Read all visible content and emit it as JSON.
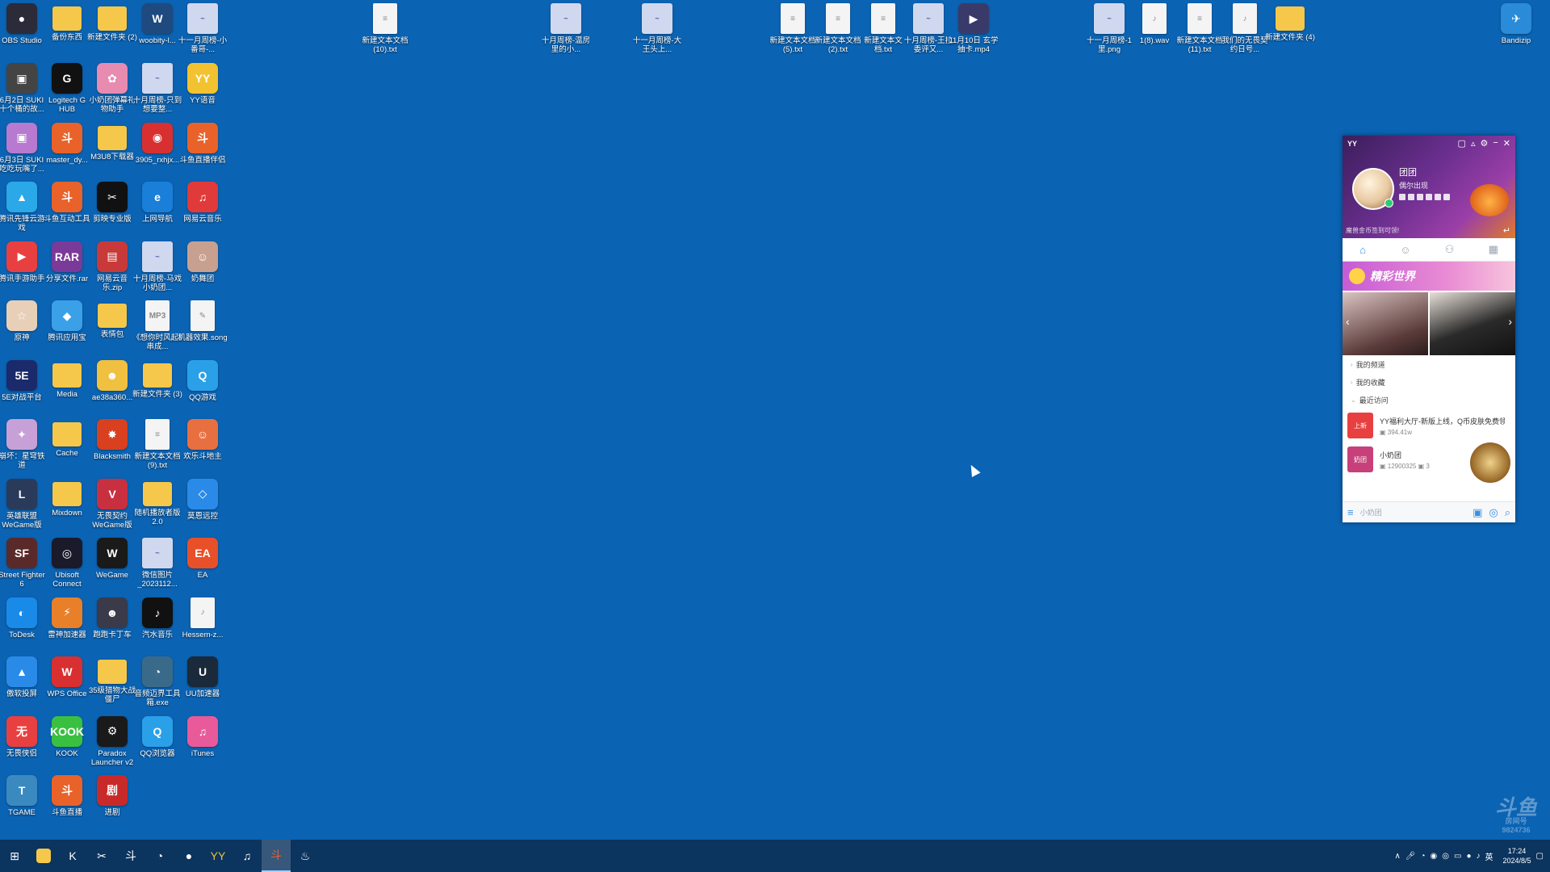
{
  "desktop": {
    "icons": [
      {
        "label": "OBS Studio",
        "color": "#2b2b3a",
        "kind": "app",
        "text": "●"
      },
      {
        "label": "新建文本文档 (10).txt",
        "kind": "doc",
        "text": "≡"
      },
      {
        "label": "十月周榜-温房里的小...",
        "kind": "pic",
        "text": "~"
      },
      {
        "label": "十一月周榜-大王头上...",
        "kind": "pic",
        "text": "~"
      },
      {
        "label": "新建文本文档 (5).txt",
        "kind": "doc",
        "text": "≡"
      },
      {
        "label": "新建文本文档 (2).txt",
        "kind": "doc",
        "text": "≡"
      },
      {
        "label": "新建文本文档.txt",
        "kind": "doc",
        "text": "≡"
      },
      {
        "label": "十月周榜-王拉委评又...",
        "kind": "pic",
        "text": "~"
      },
      {
        "label": "11月10日 玄学抽卡.mp4",
        "color": "#3a3a6a",
        "kind": "app",
        "text": "▶"
      },
      {
        "label": "十一月周榜-1里.png",
        "kind": "pic",
        "text": "~"
      },
      {
        "label": "1(8).wav",
        "kind": "doc",
        "text": "♪"
      },
      {
        "label": "新建文本文档 (11).txt",
        "kind": "doc",
        "text": "≡"
      },
      {
        "label": "我们的无畏契约日号...",
        "kind": "doc",
        "text": "♪"
      },
      {
        "label": "新建文件夹 (4)",
        "kind": "folder",
        "text": ""
      },
      {
        "label": "Bandizip",
        "color": "#2a8bd8",
        "kind": "app",
        "text": "✈"
      },
      {
        "label": "备份东西",
        "kind": "folder",
        "text": ""
      },
      {
        "label": "新建文件夹 (2)",
        "kind": "folder",
        "text": ""
      },
      {
        "label": "woobity-l...",
        "color": "#1e4a80",
        "kind": "app",
        "text": "W"
      },
      {
        "label": "十一月周榜-小番哥-...",
        "kind": "pic",
        "text": "~"
      },
      {
        "label": "6月2日 SUKI 十个桶的故...",
        "color": "#444",
        "kind": "app",
        "text": "▣"
      },
      {
        "label": "Logitech G HUB",
        "color": "#111",
        "kind": "app",
        "text": "G"
      },
      {
        "label": "小奶团弹幕礼物助手",
        "color": "#e88bb0",
        "kind": "app",
        "text": "✿"
      },
      {
        "label": "十月周榜-只到想要整...",
        "kind": "pic",
        "text": "~"
      },
      {
        "label": "YY语音",
        "color": "#f2c230",
        "kind": "app",
        "text": "YY"
      },
      {
        "label": "6月3日 SUKI 吃吃玩嘴了...",
        "color": "#b77ad0",
        "kind": "app",
        "text": "▣"
      },
      {
        "label": "master_dy...",
        "color": "#e8622a",
        "kind": "app",
        "text": "斗"
      },
      {
        "label": "M3U8下载器",
        "kind": "folder",
        "text": ""
      },
      {
        "label": "3905_rxhjx...",
        "color": "#d83030",
        "kind": "app",
        "text": "◉"
      },
      {
        "label": "斗鱼直播伴侣",
        "color": "#e8622a",
        "kind": "app",
        "text": "斗"
      },
      {
        "label": "腾讯先锋云游戏",
        "color": "#2aa8e8",
        "kind": "app",
        "text": "▲"
      },
      {
        "label": "斗鱼互动工具",
        "color": "#e8622a",
        "kind": "app",
        "text": "斗"
      },
      {
        "label": "剪映专业版",
        "color": "#111",
        "kind": "app",
        "text": "✂"
      },
      {
        "label": "上网导航",
        "color": "#1a7fd8",
        "kind": "app",
        "text": "e"
      },
      {
        "label": "网易云音乐",
        "color": "#e03a3a",
        "kind": "app",
        "text": "♫"
      },
      {
        "label": "腾讯手游助手",
        "color": "#e84040",
        "kind": "app",
        "text": "▶"
      },
      {
        "label": "分享文件.rar",
        "color": "#7a3a9a",
        "kind": "app",
        "text": "RAR"
      },
      {
        "label": "网易云音乐.zip",
        "color": "#c83a3a",
        "kind": "app",
        "text": "▤"
      },
      {
        "label": "十月周榜-马戏小奶团...",
        "kind": "pic",
        "text": "~"
      },
      {
        "label": "奶舞团",
        "color": "#c8a090",
        "kind": "app",
        "text": "☺"
      },
      {
        "label": "原神",
        "color": "#e8d0b8",
        "kind": "app",
        "text": "☆"
      },
      {
        "label": "腾讯应用宝",
        "color": "#3aa0e8",
        "kind": "app",
        "text": "◆"
      },
      {
        "label": "表情包",
        "kind": "folder",
        "text": ""
      },
      {
        "label": "《想你时风起》串成...",
        "kind": "doc",
        "text": "MP3"
      },
      {
        "label": "机器效果.song",
        "kind": "doc",
        "text": "✎"
      },
      {
        "label": "5E对战平台",
        "color": "#1a2a6a",
        "kind": "app",
        "text": "5E"
      },
      {
        "label": "Media",
        "kind": "folder",
        "text": ""
      },
      {
        "label": "ae38a360...",
        "color": "#f0c040",
        "kind": "app",
        "text": "☻"
      },
      {
        "label": "新建文件夹 (3)",
        "kind": "folder",
        "text": ""
      },
      {
        "label": "QQ游戏",
        "color": "#2aa0e8",
        "kind": "app",
        "text": "Q"
      },
      {
        "label": "崩坏：星穹铁道",
        "color": "#c8a0d8",
        "kind": "app",
        "text": "✦"
      },
      {
        "label": "Cache",
        "kind": "folder",
        "text": ""
      },
      {
        "label": "Blacksmith",
        "color": "#d84020",
        "kind": "app",
        "text": "✸"
      },
      {
        "label": "新建文本文档 (9).txt",
        "kind": "doc",
        "text": "≡"
      },
      {
        "label": "欢乐斗地主",
        "color": "#e87040",
        "kind": "app",
        "text": "☺"
      },
      {
        "label": "英雄联盟WeGame版",
        "color": "#2a3a5a",
        "kind": "app",
        "text": "L"
      },
      {
        "label": "Mixdown",
        "kind": "folder",
        "text": ""
      },
      {
        "label": "无畏契约WeGame版",
        "color": "#c83040",
        "kind": "app",
        "text": "V"
      },
      {
        "label": "随机播放者版2.0",
        "kind": "folder",
        "text": ""
      },
      {
        "label": "莫恩远控",
        "color": "#2a8ae8",
        "kind": "app",
        "text": "◇"
      },
      {
        "label": "Street Fighter 6",
        "color": "#5a2a2a",
        "kind": "app",
        "text": "SF"
      },
      {
        "label": "Ubisoft Connect",
        "color": "#1a1a2a",
        "kind": "app",
        "text": "◎"
      },
      {
        "label": "WeGame",
        "color": "#1a1a1a",
        "kind": "app",
        "text": "W"
      },
      {
        "label": "微信图片_2023112...",
        "kind": "pic",
        "text": "~"
      },
      {
        "label": "EA",
        "color": "#e8502a",
        "kind": "app",
        "text": "EA"
      },
      {
        "label": "ToDesk",
        "color": "#1a8ae8",
        "kind": "app",
        "text": "◐"
      },
      {
        "label": "雷神加速器",
        "color": "#e8802a",
        "kind": "app",
        "text": "⚡"
      },
      {
        "label": "跑跑卡丁车",
        "color": "#3a3a4a",
        "kind": "app",
        "text": "☻"
      },
      {
        "label": "汽水音乐",
        "color": "#111",
        "kind": "app",
        "text": "♪"
      },
      {
        "label": "Hessem-z...",
        "kind": "doc",
        "text": "♪"
      },
      {
        "label": "傲软投屏",
        "color": "#2a8ae8",
        "kind": "app",
        "text": "▲"
      },
      {
        "label": "WPS Office",
        "color": "#d83030",
        "kind": "app",
        "text": "W"
      },
      {
        "label": "35级猎物大战僵尸",
        "kind": "folder",
        "text": ""
      },
      {
        "label": "音频迈界工具箱.exe",
        "color": "#3a6a8a",
        "kind": "app",
        "text": "◔"
      },
      {
        "label": "UU加速器",
        "color": "#1a2a3a",
        "kind": "app",
        "text": "U"
      },
      {
        "label": "无畏侠侣",
        "color": "#e84040",
        "kind": "app",
        "text": "无"
      },
      {
        "label": "KOOK",
        "color": "#3ac040",
        "kind": "app",
        "text": "KOOK"
      },
      {
        "label": "Paradox Launcher v2",
        "color": "#1a1a1a",
        "kind": "app",
        "text": "⚙"
      },
      {
        "label": "QQ浏览器",
        "color": "#2aa0e8",
        "kind": "app",
        "text": "Q"
      },
      {
        "label": "iTunes",
        "color": "#e85a9a",
        "kind": "app",
        "text": "♫"
      },
      {
        "label": "TGAME",
        "color": "#3a8ac0",
        "kind": "app",
        "text": "T"
      },
      {
        "label": "斗鱼直播",
        "color": "#e8622a",
        "kind": "app",
        "text": "斗"
      },
      {
        "label": "进剧",
        "color": "#c82a2a",
        "kind": "app",
        "text": "剧"
      }
    ]
  },
  "yy": {
    "logo": "YY",
    "username": "团团",
    "status": "偶尔出现",
    "notice": "魔兽金币签到可领!",
    "banner": "精彩世界",
    "menu": [
      "我的频道",
      "我的收藏",
      "最近访问"
    ],
    "channels": [
      {
        "title": "YY福利大厅-新版上线，Q币皮肤免费领",
        "sub": "394.41w",
        "color": "#e84040",
        "badge": "上新"
      },
      {
        "title": "小奶团",
        "sub": "12900325",
        "count": "3",
        "color": "#c8407a",
        "badge": "奶团"
      }
    ],
    "search_placeholder": "小奶团"
  },
  "taskbar": {
    "apps": [
      {
        "name": "start",
        "glyph": "⊞",
        "color": ""
      },
      {
        "name": "explorer",
        "glyph": "",
        "color": "#f5c84b"
      },
      {
        "name": "kook",
        "glyph": "K",
        "color": ""
      },
      {
        "name": "capcut",
        "glyph": "✂",
        "color": ""
      },
      {
        "name": "douyu",
        "glyph": "斗",
        "color": ""
      },
      {
        "name": "browser",
        "glyph": "◔",
        "color": ""
      },
      {
        "name": "obs",
        "glyph": "●",
        "color": ""
      },
      {
        "name": "yy",
        "glyph": "YY",
        "color": "#f2c230"
      },
      {
        "name": "netease",
        "glyph": "♫",
        "color": ""
      },
      {
        "name": "douyu-live",
        "glyph": "斗",
        "color": "#e8622a",
        "active": true
      },
      {
        "name": "steam",
        "glyph": "♨",
        "color": ""
      }
    ],
    "tray_lang": "英",
    "time": "17:24",
    "date": "2024/8/5"
  },
  "watermark": {
    "text": "斗鱼",
    "sub": "房间号",
    "room": "9824736"
  }
}
